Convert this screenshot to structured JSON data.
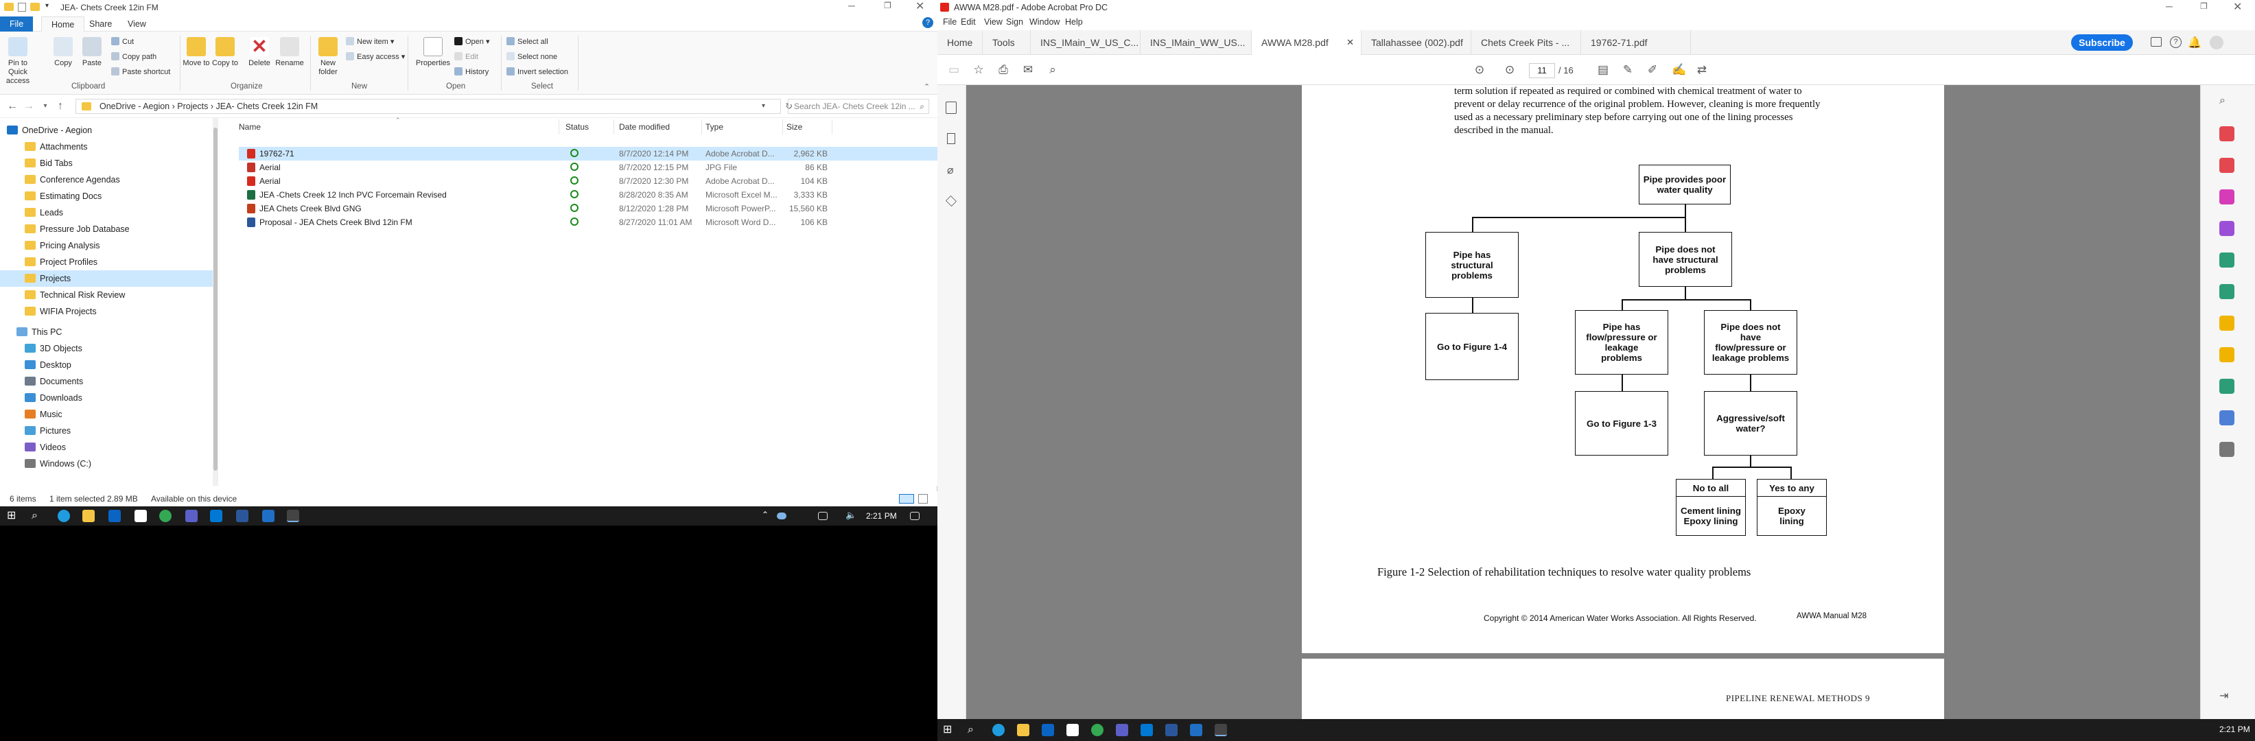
{
  "explorer": {
    "title": "JEA- Chets Creek 12in FM",
    "tabs": [
      "File",
      "Home",
      "Share",
      "View"
    ],
    "ribbon": {
      "clipboard": {
        "pin": "Pin to Quick access",
        "copy": "Copy",
        "paste": "Paste",
        "cut": "Cut",
        "copy_path": "Copy path",
        "paste_shortcut": "Paste shortcut",
        "label": "Clipboard"
      },
      "organize": {
        "move": "Move to",
        "copy": "Copy to",
        "delete": "Delete",
        "rename": "Rename",
        "label": "Organize"
      },
      "new": {
        "folder": "New folder",
        "item": "New item",
        "easy": "Easy access",
        "label": "New"
      },
      "open": {
        "properties": "Properties",
        "open": "Open",
        "edit": "Edit",
        "history": "History",
        "label": "Open"
      },
      "select": {
        "all": "Select all",
        "none": "Select none",
        "invert": "Invert selection",
        "label": "Select"
      }
    },
    "path": "OneDrive - Aegion  ›  Projects  ›  JEA- Chets Creek 12in FM",
    "search_placeholder": "Search JEA- Chets Creek 12in ...",
    "nav": [
      "OneDrive - Aegion",
      "Attachments",
      "Bid Tabs",
      "Conference Agendas",
      "Estimating Docs",
      "Leads",
      "Pressure Job Database",
      "Pricing Analysis",
      "Project Profiles",
      "Projects",
      "Technical Risk Review",
      "WIFIA Projects",
      "This PC",
      "3D Objects",
      "Desktop",
      "Documents",
      "Downloads",
      "Music",
      "Pictures",
      "Videos",
      "Windows (C:)"
    ],
    "columns": {
      "name": "Name",
      "status": "Status",
      "date": "Date modified",
      "type": "Type",
      "size": "Size"
    },
    "files": [
      {
        "name": "19762-71",
        "date": "8/7/2020 12:14 PM",
        "type": "Adobe Acrobat D...",
        "size": "2,962 KB",
        "color": "#d62b1f"
      },
      {
        "name": "Aerial",
        "date": "8/7/2020 12:15 PM",
        "type": "JPG File",
        "size": "86 KB",
        "color": "#c5342a"
      },
      {
        "name": "Aerial",
        "date": "8/7/2020 12:30 PM",
        "type": "Adobe Acrobat D...",
        "size": "104 KB",
        "color": "#d62b1f"
      },
      {
        "name": "JEA -Chets Creek 12 Inch PVC Forcemain Revised",
        "date": "8/28/2020 8:35 AM",
        "type": "Microsoft Excel M...",
        "size": "3,333 KB",
        "color": "#1d6f42"
      },
      {
        "name": "JEA Chets Creek Blvd GNG",
        "date": "8/12/2020 1:28 PM",
        "type": "Microsoft PowerP...",
        "size": "15,560 KB",
        "color": "#c43e1c"
      },
      {
        "name": "Proposal - JEA Chets Creek Blvd 12in FM",
        "date": "8/27/2020 11:01 AM",
        "type": "Microsoft Word D...",
        "size": "106 KB",
        "color": "#2b579a"
      }
    ],
    "status": {
      "items": "6 items",
      "selected": "1 item selected  2.89 MB",
      "avail": "Available on this device"
    },
    "clock": "2:21 PM"
  },
  "acrobat": {
    "title": "AWWA M28.pdf - Adobe Acrobat Pro DC",
    "menu": [
      "File",
      "Edit",
      "View",
      "Sign",
      "Window",
      "Help"
    ],
    "tabs": [
      "Home",
      "Tools",
      "INS_IMain_W_US_C...",
      "INS_IMain_WW_US...",
      "AWWA M28.pdf",
      "Tallahassee (002).pdf",
      "Chets Creek Pits - ...",
      "19762-71.pdf"
    ],
    "subscribe": "Subscribe",
    "page_current": "11",
    "page_total": "/  16",
    "para": [
      "term solution if repeated as required or combined with chemical treatment of water to",
      "prevent or delay recurrence of the original problem. However, cleaning is more frequently",
      "used as a necessary preliminary step before carrying out one of the lining processes",
      "described in the manual."
    ],
    "flow": {
      "root": "Pipe provides poor water quality",
      "structural": "Pipe has structural problems",
      "not_structural": "Pipe does not have structural problems",
      "fig14": "Go to Figure 1-4",
      "flow": "Pipe has flow/pressure or leakage problems",
      "no_flow": "Pipe does not have flow/pressure or leakage problems",
      "fig13": "Go to Figure 1-3",
      "aggressive": "Aggressive/soft water?",
      "no_all": "No to all",
      "yes_any": "Yes to any",
      "cement": "Cement lining Epoxy lining",
      "epoxy": "Epoxy lining"
    },
    "caption": "Figure 1-2    Selection of rehabilitation techniques to resolve water quality problems",
    "copyright": "Copyright © 2014 American Water Works Association. All Rights Reserved.",
    "manual": "AWWA Manual M28",
    "footer": "PIPELINE RENEWAL METHODS    9",
    "clock": "2:21 PM"
  }
}
